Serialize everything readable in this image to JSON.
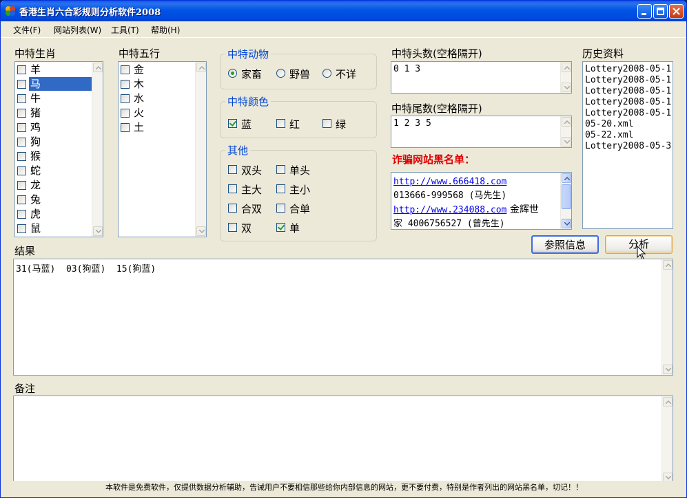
{
  "window": {
    "title": "香港生肖六合彩规则分析软件2008"
  },
  "menu": [
    {
      "label": "文件(F)"
    },
    {
      "label": "网站列表(W)"
    },
    {
      "label": "工具(T)"
    },
    {
      "label": "帮助(H)"
    }
  ],
  "zodiac": {
    "label": "中特生肖",
    "items": [
      {
        "label": "羊",
        "checked": false
      },
      {
        "label": "马",
        "checked": false,
        "selected": true
      },
      {
        "label": "牛",
        "checked": false
      },
      {
        "label": "猪",
        "checked": false
      },
      {
        "label": "鸡",
        "checked": false
      },
      {
        "label": "狗",
        "checked": false
      },
      {
        "label": "猴",
        "checked": false
      },
      {
        "label": "蛇",
        "checked": false
      },
      {
        "label": "龙",
        "checked": false
      },
      {
        "label": "兔",
        "checked": false
      },
      {
        "label": "虎",
        "checked": false
      },
      {
        "label": "鼠",
        "checked": false
      }
    ]
  },
  "elements": {
    "label": "中特五行",
    "items": [
      {
        "label": "金",
        "checked": false
      },
      {
        "label": "木",
        "checked": false
      },
      {
        "label": "水",
        "checked": false
      },
      {
        "label": "火",
        "checked": false
      },
      {
        "label": "土",
        "checked": false
      }
    ]
  },
  "animal_group": {
    "title": "中特动物",
    "options": [
      {
        "label": "家畜",
        "selected": true
      },
      {
        "label": "野兽",
        "selected": false
      },
      {
        "label": "不详",
        "selected": false
      }
    ]
  },
  "color_group": {
    "title": "中特颜色",
    "options": [
      {
        "label": "蓝",
        "checked": true
      },
      {
        "label": "红",
        "checked": false
      },
      {
        "label": "绿",
        "checked": false
      }
    ]
  },
  "other_group": {
    "title": "其他",
    "options": [
      {
        "label": "双头",
        "checked": false
      },
      {
        "label": "单头",
        "checked": false
      },
      {
        "label": "主大",
        "checked": false
      },
      {
        "label": "主小",
        "checked": false
      },
      {
        "label": "合双",
        "checked": false
      },
      {
        "label": "合单",
        "checked": false
      },
      {
        "label": "双",
        "checked": false
      },
      {
        "label": "单",
        "checked": true
      }
    ]
  },
  "head_numbers": {
    "label": "中特头数(空格隔开)",
    "value": "0 1 3"
  },
  "tail_numbers": {
    "label": "中特尾数(空格隔开)",
    "value": "1 2 3 5"
  },
  "blacklist": {
    "heading": "诈骗网站黑名单：",
    "lines": [
      {
        "link": "http://www.666418.com",
        "text": ""
      },
      {
        "link": "",
        "text": "013666-999568 (马先生)"
      },
      {
        "link": "http://www.234088.com",
        "text": " 金辉世"
      },
      {
        "link": "",
        "text": "家 4006756527 (曾先生)"
      }
    ]
  },
  "history": {
    "label": "历史资料",
    "items": [
      "Lottery2008-05-1",
      "Lottery2008-05-1",
      "Lottery2008-05-1",
      "Lottery2008-05-1",
      "Lottery2008-05-1",
      "05-20.xml",
      "05-22.xml",
      "Lottery2008-05-3"
    ]
  },
  "buttons": {
    "reference": "参照信息",
    "analyze": "分析"
  },
  "result": {
    "label": "结果",
    "value": "31(马蓝)  03(狗蓝)  15(狗蓝)"
  },
  "notes": {
    "label": "备注",
    "value": ""
  },
  "footer": {
    "text": "本软件是免费软件，仅提供数据分析辅助，告诫用户不要相信那些给你内部信息的网站，更不要付费，特别是作者列出的网站黑名单，切记！！"
  },
  "colors": {
    "accent": "#0046d5",
    "warning": "#e00000",
    "selection": "#316ac5"
  }
}
